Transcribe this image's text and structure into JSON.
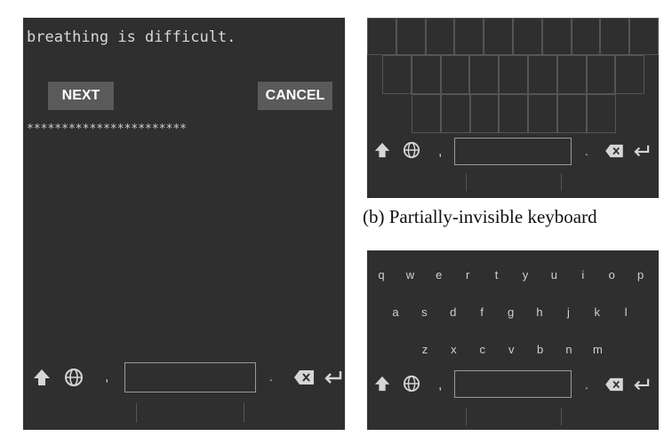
{
  "panel_a": {
    "prompt": "breathing is difficult.",
    "next_label": "NEXT",
    "cancel_label": "CANCEL",
    "password_mask": "***********************",
    "comma": ",",
    "period": ".",
    "icons": [
      "shift-icon",
      "globe-icon",
      "backspace-icon",
      "enter-icon"
    ]
  },
  "panel_b": {
    "caption": "(b) Partially-invisible keyboard",
    "comma": ",",
    "period": "."
  },
  "panel_c": {
    "rows": [
      [
        "q",
        "w",
        "e",
        "r",
        "t",
        "y",
        "u",
        "i",
        "o",
        "p"
      ],
      [
        "a",
        "s",
        "d",
        "f",
        "g",
        "h",
        "j",
        "k",
        "l"
      ],
      [
        "z",
        "x",
        "c",
        "v",
        "b",
        "n",
        "m"
      ]
    ],
    "comma": ",",
    "period": "."
  }
}
